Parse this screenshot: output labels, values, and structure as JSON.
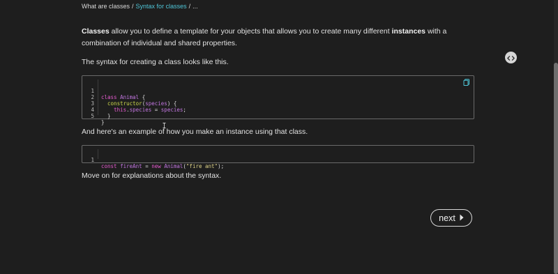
{
  "breadcrumb": {
    "item1": "What are classes",
    "sep1": "/",
    "item2": "Syntax for classes",
    "sep2": "/",
    "item3": "..."
  },
  "paragraphs": {
    "p1_bold1": "Classes",
    "p1_text1": " allow you to define a template for your objects that allows you to create many different ",
    "p1_bold2": "instances",
    "p1_text2": " with a combination of individual and shared properties.",
    "p2": "The syntax for creating a class looks like this.",
    "p3": "And here's an example of how you make an instance using that class.",
    "p4": "Move on for explanations about the syntax."
  },
  "code1": {
    "lines": [
      {
        "num": "1"
      },
      {
        "num": "2"
      },
      {
        "num": "3"
      },
      {
        "num": "4"
      },
      {
        "num": "5"
      }
    ],
    "tokens": {
      "l1_kw": "class",
      "l1_cls": "Animal",
      "l1_rest": " {",
      "l2_indent": "  ",
      "l2_fn": "constructor",
      "l2_open": "(",
      "l2_prm": "species",
      "l2_close": ") {",
      "l3_indent": "    ",
      "l3_this": "this",
      "l3_dot": ".",
      "l3_prop": "species",
      "l3_eq": " = ",
      "l3_val": "species",
      "l3_semi": ";",
      "l4": "  }",
      "l5": "}"
    }
  },
  "code2": {
    "lines": [
      {
        "num": "1"
      }
    ],
    "tokens": {
      "kw": "const",
      "var": "fireAnt",
      "eq": " = ",
      "new": "new",
      "cls": "Animal",
      "open": "(",
      "str": "\"fire ant\"",
      "close": ");"
    }
  },
  "icons": {
    "copy": "copy-icon",
    "toggle": "code-brackets-icon",
    "next": "caret-right-icon",
    "cursor": "text-cursor-icon"
  },
  "next_button": {
    "label": "next"
  },
  "colors": {
    "background": "#1e1e1e",
    "link": "#4fc6d8",
    "keyword": "#e65bd0",
    "function": "#cbd84a"
  }
}
